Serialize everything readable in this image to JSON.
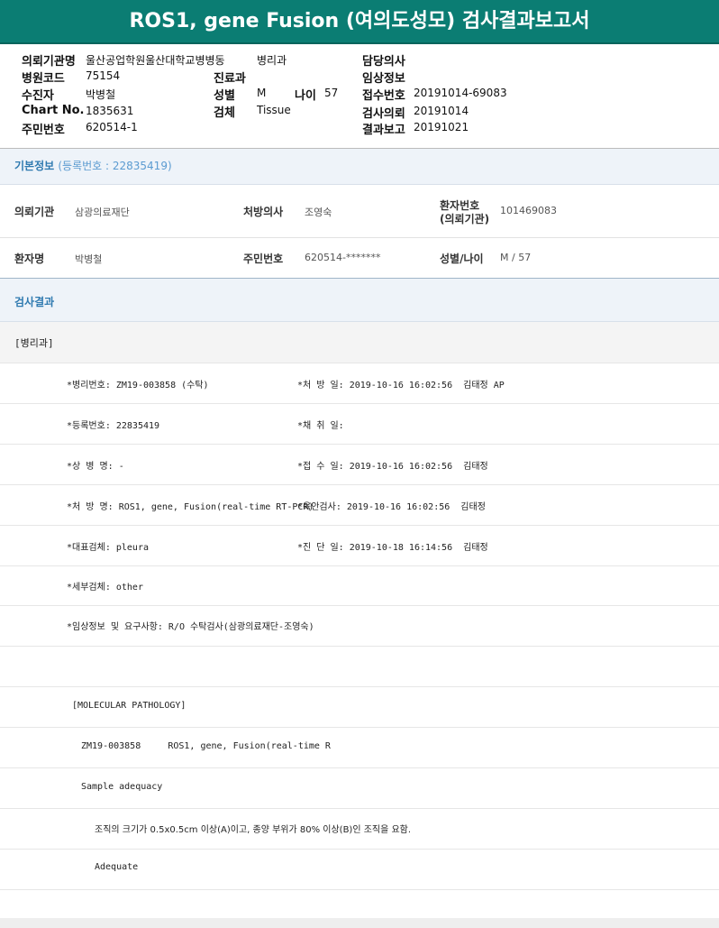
{
  "title": "ROS1, gene Fusion (여의도성모) 검사결과보고서",
  "header": {
    "institution_label": "의뢰기관명",
    "institution_value": "울산공업학원울산대학교병병동",
    "ward_value": "병리과",
    "doctor_label": "담당의사",
    "hospital_code_label": "병원코드",
    "hospital_code_value": "75154",
    "dept_label": "진료과",
    "clinical_label": "임상정보",
    "receiver_label": "수진자",
    "receiver_value": "박병철",
    "sex_label": "성별",
    "sex_value": "M",
    "age_label": "나이",
    "age_value": "57",
    "receipt_no_label": "접수번호",
    "receipt_no_value": "20191014-69083",
    "chart_label": "Chart No.",
    "chart_value": "1835631",
    "specimen_label": "검체",
    "specimen_value": "Tissue",
    "request_label": "검사의뢰",
    "request_value": "20191014",
    "ssn_label": "주민번호",
    "ssn_value": "620514-1",
    "report_label": "결과보고",
    "report_value": "20191021"
  },
  "basic": {
    "section_title": "기본정보",
    "section_sub": "(등록번호 : 22835419)",
    "req_inst_label": "의뢰기관",
    "req_inst_value": "삼광의료재단",
    "doctor_label": "처방의사",
    "doctor_value": "조영숙",
    "patient_no_label_1": "환자번호",
    "patient_no_label_2": "(의뢰기관)",
    "patient_no_value": "101469083",
    "patient_name_label": "환자명",
    "patient_name_value": "박병철",
    "ssn_label": "주민번호",
    "ssn_value": "620514-*******",
    "sexage_label": "성별/나이",
    "sexage_value": "M / 57"
  },
  "results": {
    "section_title": "검사결과",
    "dept_tag": "[병리과]",
    "lines_left": [
      "*병리번호: ZM19-003858 (수탁)",
      "*등록번호: 22835419",
      "*상 병 명: -",
      "*처 방 명: ROS1, gene, Fusion(real-time RT-PCR)",
      "*대표검체: pleura",
      "*세부검체: other",
      "*임상정보 및 요구사항: R/O 수탁검사(삼광의료재단-조영숙)"
    ],
    "lines_right": [
      "*처 방 일: 2019-10-16 16:02:56  김태정 AP",
      "*채 취 일:",
      "*접 수 일: 2019-10-16 16:02:56  김태정",
      "*육안검사: 2019-10-16 16:02:56  김태정",
      "*진 단 일: 2019-10-18 16:14:56  김태정"
    ],
    "mp_header": "[MOLECULAR PATHOLOGY]",
    "mp_line1": "ZM19-003858     ROS1, gene, Fusion(real-time R",
    "mp_line2": "Sample adequacy",
    "mp_line3": "조직의 크기가 0.5x0.5cm 이상(A)이고, 종양 부위가 80% 이상(B)인 조직을 요함.",
    "mp_line4": "Adequate"
  }
}
